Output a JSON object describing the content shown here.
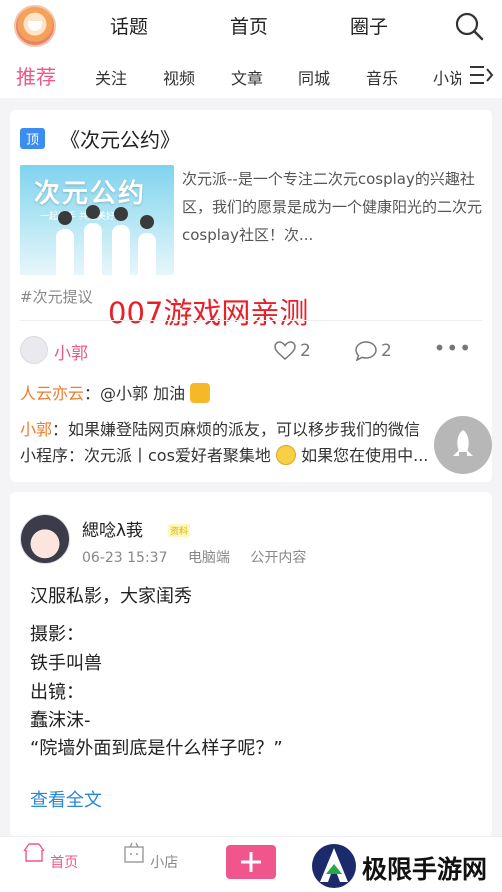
{
  "topbar": {
    "tabs": [
      "话题",
      "首页",
      "圈子"
    ]
  },
  "channels": [
    "推荐",
    "关注",
    "视频",
    "文章",
    "同城",
    "音乐",
    "小说"
  ],
  "pinned_post": {
    "pin_label": "顶",
    "title": "《次元公约》",
    "thumb_title": "次元公约",
    "thumb_subtitle": "一起携手  共建美好",
    "excerpt": "次元派--是一个专注二次元cosplay的兴趣社区，我们的愿景是成为一个健康阳光的二次元cosplay社区！次...",
    "tag": "#次元提议",
    "author": "小郭",
    "likes": "2",
    "comments": "2",
    "comment_list": [
      {
        "name": "人云亦云",
        "text": "：@小郭 加油"
      },
      {
        "name": "小郭",
        "text": "：如果嫌登陆网页麻烦的派友，可以移步我们的微信"
      },
      {
        "name": "",
        "text": "小程序：次元派丨cos爱好者聚集地"
      },
      {
        "name": "",
        "text": " 如果您在使用中..."
      }
    ]
  },
  "watermark": "007游戏网亲测",
  "post2": {
    "username": "緦唸λ莪",
    "badge": "资料",
    "date": "06-23 15:37",
    "device": "电脑端",
    "visibility": "公开内容",
    "lines": [
      "汉服私影，大家闺秀",
      "摄影：",
      "铁手叫兽",
      "出镜：",
      "蠢沫沫-",
      "“院墙外面到底是什么样子呢？”"
    ],
    "read_more": "查看全文"
  },
  "bottomnav": {
    "home": "首页",
    "shop": "小店"
  },
  "logo_watermark": "极限手游网",
  "colors": {
    "accent": "#f0568b",
    "link": "#2b87d6",
    "pin": "#3b8ef0",
    "watermark": "#e8202a"
  }
}
